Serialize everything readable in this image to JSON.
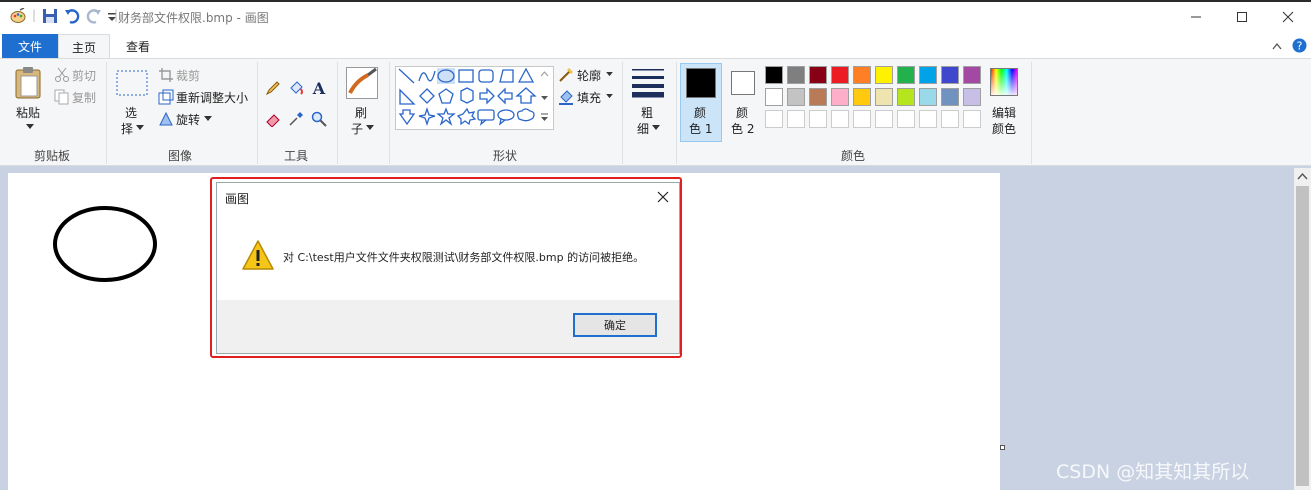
{
  "title_bar": {
    "title": "财务部文件权限.bmp - 画图",
    "app_icon": "paint-palette-icon",
    "quick_access": [
      "save-icon",
      "undo-icon",
      "redo-icon",
      "customize-dropdown-icon"
    ],
    "window_controls": [
      "minimize",
      "maximize",
      "close"
    ]
  },
  "tabs": {
    "file": "文件",
    "home": "主页",
    "view": "查看"
  },
  "ribbon": {
    "clipboard": {
      "paste": "粘贴",
      "cut": "剪切",
      "copy": "复制",
      "group_label": "剪贴板"
    },
    "image": {
      "select_1": "选",
      "select_2": "择",
      "crop": "裁剪",
      "resize": "重新调整大小",
      "rotate": "旋转",
      "group_label": "图像"
    },
    "tools": {
      "group_label": "工具"
    },
    "brushes": {
      "label_1": "刷",
      "label_2": "子"
    },
    "shapes": {
      "outline": "轮廓",
      "fill": "填充",
      "group_label": "形状"
    },
    "size": {
      "label_1": "粗",
      "label_2": "细"
    },
    "colors": {
      "color1_label_1": "颜",
      "color1_label_2": "色 1",
      "color2_label_1": "颜",
      "color2_label_2": "色 2",
      "color1_value": "#000000",
      "color2_value": "#ffffff",
      "edit_1": "编辑",
      "edit_2": "颜色",
      "group_label": "颜色",
      "palette_row1": [
        "#000000",
        "#7f7f7f",
        "#880015",
        "#ed1c24",
        "#ff7f27",
        "#fff200",
        "#22b14c",
        "#00a2e8",
        "#3f48cc",
        "#a349a4"
      ],
      "palette_row2": [
        "#ffffff",
        "#c3c3c3",
        "#b97a57",
        "#ffaec9",
        "#ffc90e",
        "#efe4b0",
        "#b5e61d",
        "#99d9ea",
        "#7092be",
        "#c8bfe7"
      ]
    }
  },
  "dialog": {
    "title": "画图",
    "message": "对 C:\\test用户文件文件夹权限测试\\财务部文件权限.bmp 的访问被拒绝。",
    "ok": "确定"
  },
  "watermark": "CSDN @知其知其所以"
}
